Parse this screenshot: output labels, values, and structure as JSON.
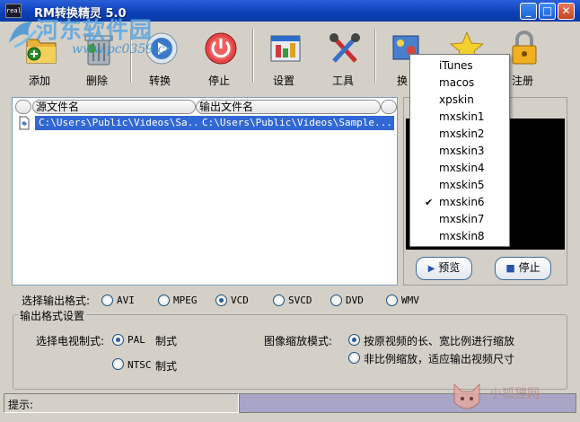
{
  "window": {
    "title": "RM转换精灵 5.0",
    "icon_label": "real"
  },
  "watermark": {
    "line1": "河东软件园",
    "line2": "www.pc0359.cn",
    "corner_text": "小狐狸网"
  },
  "toolbar": {
    "items": [
      {
        "id": "add",
        "label": "添加",
        "icon": "folder-add-icon"
      },
      {
        "id": "delete",
        "label": "删除",
        "icon": "trash-icon"
      },
      {
        "id": "convert",
        "label": "转换",
        "icon": "play-disc-icon"
      },
      {
        "id": "stop",
        "label": "停止",
        "icon": "stop-power-icon"
      },
      {
        "id": "settings",
        "label": "设置",
        "icon": "settings-icon"
      },
      {
        "id": "tools",
        "label": "工具",
        "icon": "tools-icon"
      },
      {
        "id": "skin",
        "label": "换",
        "icon": "skin-icon"
      },
      {
        "id": "star",
        "label": "",
        "icon": "star-icon"
      },
      {
        "id": "register",
        "label": "注册",
        "icon": "lock-icon"
      }
    ]
  },
  "file_list": {
    "columns": [
      "源文件名",
      "输出文件名"
    ],
    "rows": [
      {
        "source": "C:\\Users\\Public\\Videos\\Sa...",
        "output": "C:\\Users\\Public\\Videos\\Sample..."
      }
    ]
  },
  "preview": {
    "preview_label": "预览",
    "stop_label": "停止"
  },
  "output_format": {
    "label": "选择输出格式:",
    "options": [
      "AVI",
      "MPEG",
      "VCD",
      "SVCD",
      "DVD",
      "WMV"
    ],
    "selected": "VCD"
  },
  "format_settings": {
    "title": "输出格式设置",
    "tv_system_label": "选择电视制式:",
    "tv_options": [
      {
        "name": "PAL",
        "suffix": "制式"
      },
      {
        "name": "NTSC",
        "suffix": "制式"
      }
    ],
    "tv_selected": "PAL",
    "scale_label": "图像缩放模式:",
    "scale_options": [
      "按原视频的长、宽比例进行缩放",
      "非比例缩放，适应输出视频尺寸"
    ],
    "scale_selected": 0
  },
  "status": {
    "hint_label": "提示:"
  },
  "skin_menu": {
    "items": [
      "iTunes",
      "macos",
      "xpskin",
      "mxskin1",
      "mxskin2",
      "mxskin3",
      "mxskin4",
      "mxskin5",
      "mxskin6",
      "mxskin7",
      "mxskin8"
    ],
    "checked": "mxskin6",
    "check_mark": "✔"
  },
  "colors": {
    "titlebar": "#0a3fb8",
    "selection": "#3168d5",
    "status_right": "#a9a5c8"
  }
}
